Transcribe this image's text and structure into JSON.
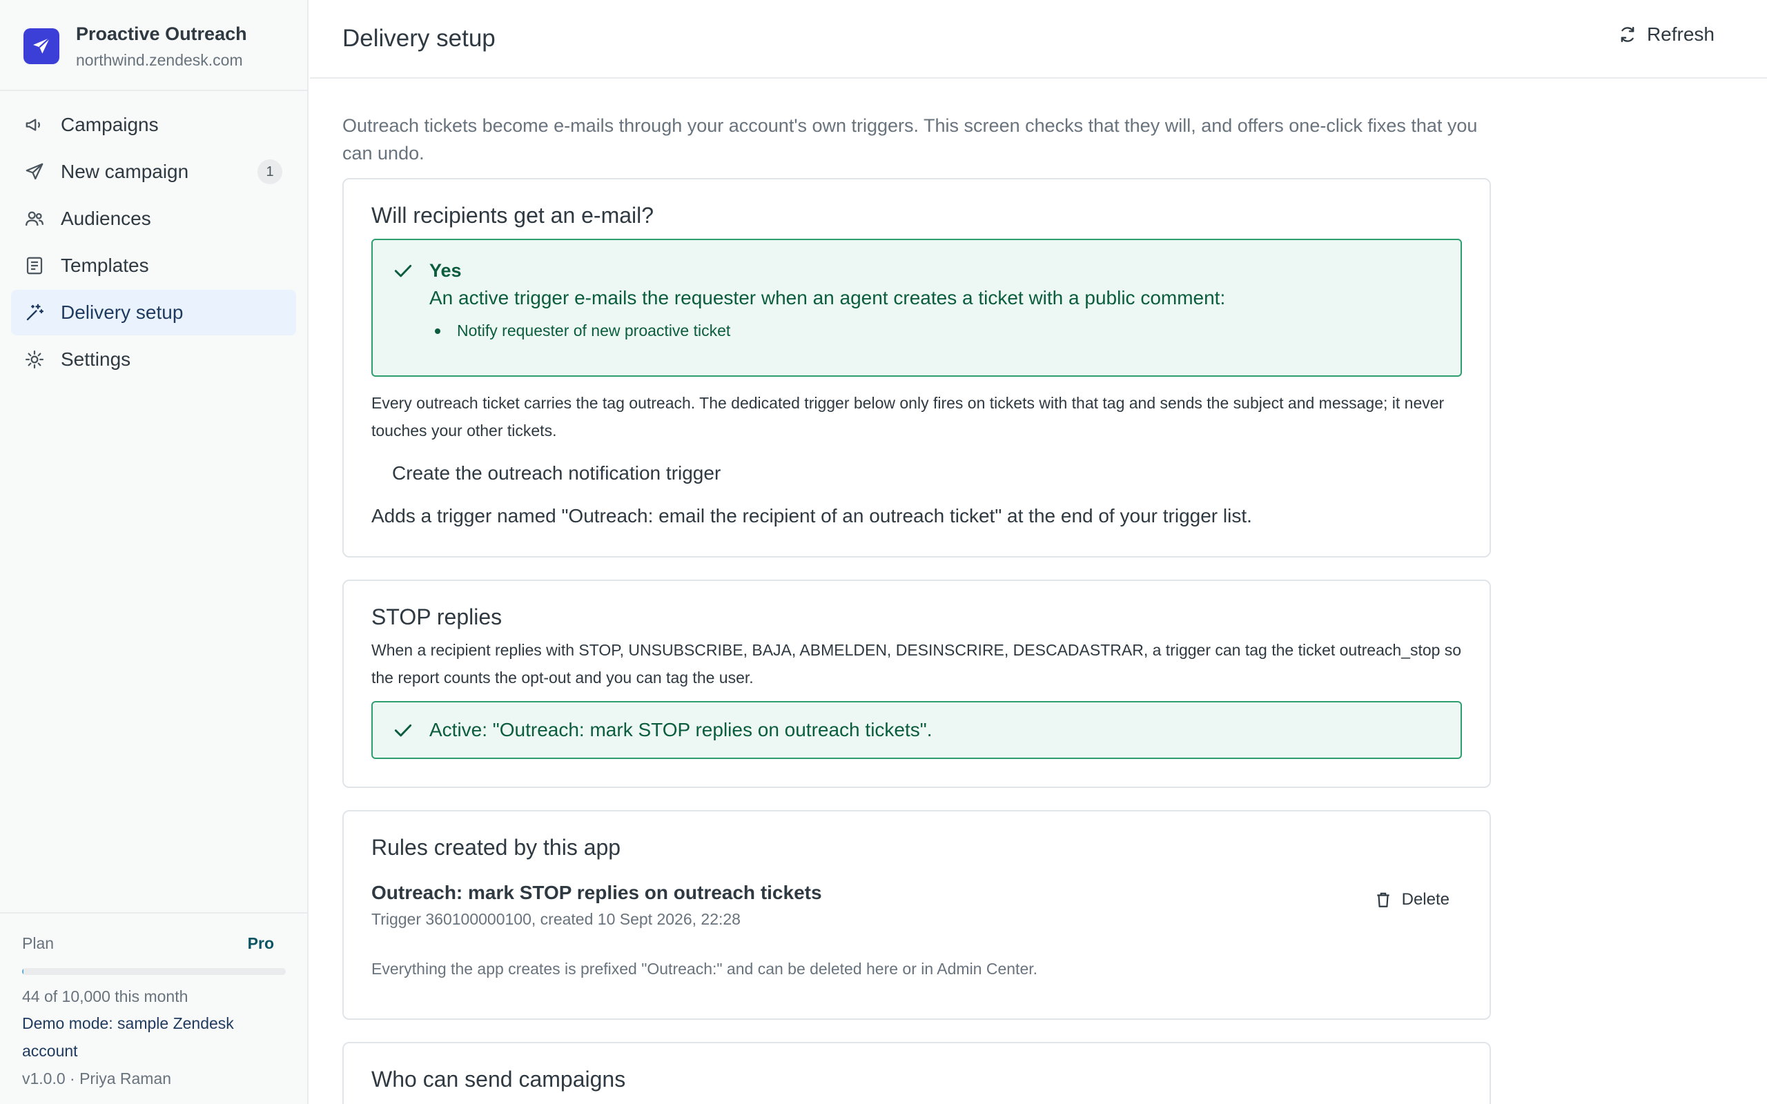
{
  "brand": {
    "name": "Proactive Outreach",
    "subdomain": "northwind.zendesk.com",
    "accent": "#3b3fd8"
  },
  "sidebar": {
    "items": [
      {
        "label": "Campaigns",
        "icon": "megaphone-icon"
      },
      {
        "label": "New campaign",
        "icon": "paper-plane-icon",
        "badge": "1"
      },
      {
        "label": "Audiences",
        "icon": "users-icon"
      },
      {
        "label": "Templates",
        "icon": "document-icon"
      },
      {
        "label": "Delivery setup",
        "icon": "magic-wand-icon",
        "active": true
      },
      {
        "label": "Settings",
        "icon": "gear-icon"
      }
    ],
    "footer": {
      "plan_label": "Plan",
      "plan_value": "Pro",
      "usage_fraction": 0.0044,
      "usage_text": "44 of 10,000 this month",
      "demo_text": "Demo mode: sample Zendesk account",
      "version_text": "v1.0.0 · Priya Raman"
    }
  },
  "header": {
    "title": "Delivery setup",
    "refresh_label": "Refresh"
  },
  "main": {
    "intro": "Outreach tickets become e-mails through your account's own triggers. This screen checks that they will, and offers one-click fixes that you can undo.",
    "email_card": {
      "title": "Will recipients get an e-mail?",
      "status_title": "Yes",
      "status_line": "An active trigger e-mails the requester when an agent creates a ticket with a public comment:",
      "status_items": [
        "Notify requester of new proactive ticket"
      ],
      "description": "Every outreach ticket carries the tag outreach. The dedicated trigger below only fires on tickets with that tag and sends the subject and message; it never touches your other tickets.",
      "action_label": "Create the outreach notification trigger",
      "action_help": "Adds a trigger named \"Outreach: email the recipient of an outreach ticket\" at the end of your trigger list."
    },
    "stop_card": {
      "title": "STOP replies",
      "description": "When a recipient replies with STOP, UNSUBSCRIBE, BAJA, ABMELDEN, DESINSCRIRE, DESCADASTRAR, a trigger can tag the ticket outreach_stop so the report counts the opt-out and you can tag the user.",
      "status": "Active: \"Outreach: mark STOP replies on outreach tickets\"."
    },
    "rules_card": {
      "title": "Rules created by this app",
      "rule_name": "Outreach: mark STOP replies on outreach tickets",
      "rule_meta": "Trigger 360100000100, created 10 Sept 2026, 22:28",
      "delete_label": "Delete",
      "footnote": "Everything the app creates is prefixed \"Outreach:\" and can be deleted here or in Admin Center."
    },
    "senders_card": {
      "title": "Who can send campaigns"
    }
  },
  "colors": {
    "success_border": "#2f9e6e",
    "success_bg": "#edf8f4",
    "success_text": "#0b5d3e",
    "active_nav_bg": "#eaf3fd"
  }
}
